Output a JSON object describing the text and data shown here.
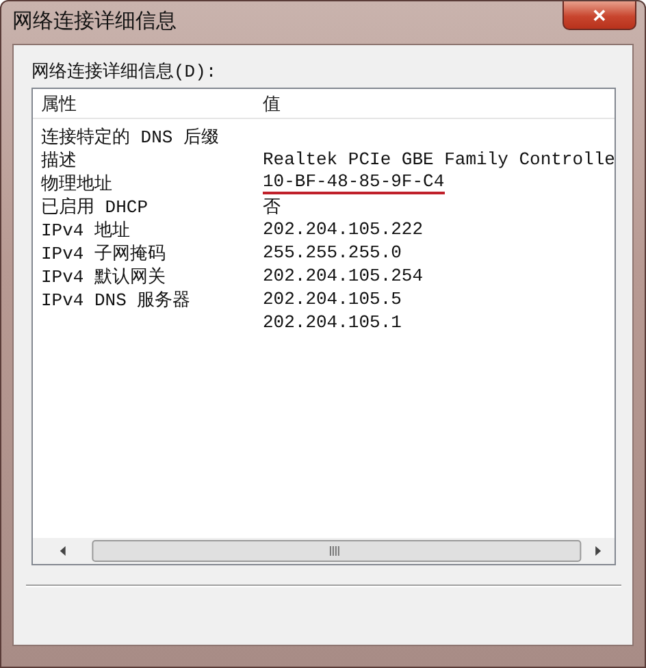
{
  "window": {
    "title": "网络连接详细信息",
    "close_glyph": "✕"
  },
  "list_label": "网络连接详细信息(D):",
  "columns": [
    "属性",
    "值"
  ],
  "rows": [
    {
      "property": "连接特定的 DNS 后缀",
      "value": "",
      "underlined": false
    },
    {
      "property": "描述",
      "value": "Realtek PCIe GBE Family Controlle",
      "underlined": false
    },
    {
      "property": "物理地址",
      "value": "10-BF-48-85-9F-C4",
      "underlined": true
    },
    {
      "property": "已启用 DHCP",
      "value": "否",
      "underlined": false
    },
    {
      "property": "IPv4 地址",
      "value": "202.204.105.222",
      "underlined": false
    },
    {
      "property": "IPv4 子网掩码",
      "value": "255.255.255.0",
      "underlined": false
    },
    {
      "property": "IPv4 默认网关",
      "value": "202.204.105.254",
      "underlined": false
    },
    {
      "property": "IPv4 DNS 服务器",
      "value": "202.204.105.5",
      "underlined": false
    },
    {
      "property": "",
      "value": "202.204.105.1",
      "underlined": false
    }
  ]
}
